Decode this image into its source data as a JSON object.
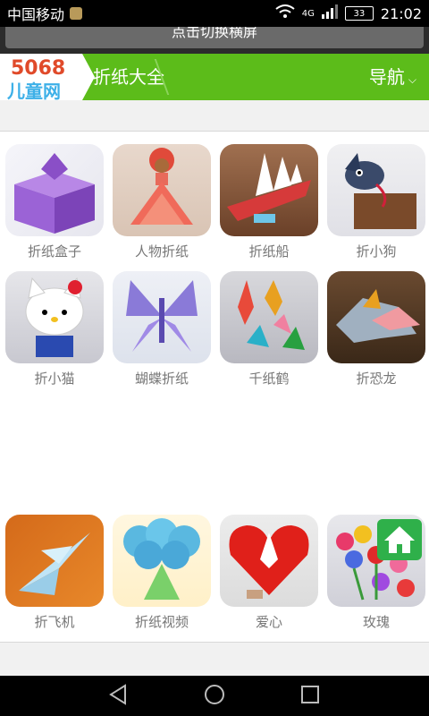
{
  "status": {
    "carrier": "中国移动",
    "network": "4G",
    "battery": "33",
    "time": "21:02"
  },
  "notice": {
    "label": "点击切换横屏"
  },
  "header": {
    "logo_top": "5068",
    "logo_bottom": "儿童网",
    "title": "折纸大全",
    "nav_label": "导航"
  },
  "items": [
    {
      "label": "折纸盒子"
    },
    {
      "label": "人物折纸"
    },
    {
      "label": "折纸船"
    },
    {
      "label": "折小狗"
    },
    {
      "label": "折小猫"
    },
    {
      "label": "蝴蝶折纸"
    },
    {
      "label": "千纸鹤"
    },
    {
      "label": "折恐龙"
    },
    {
      "label": "折飞机"
    },
    {
      "label": "折纸视频"
    },
    {
      "label": "爱心"
    },
    {
      "label": "玫瑰"
    }
  ]
}
